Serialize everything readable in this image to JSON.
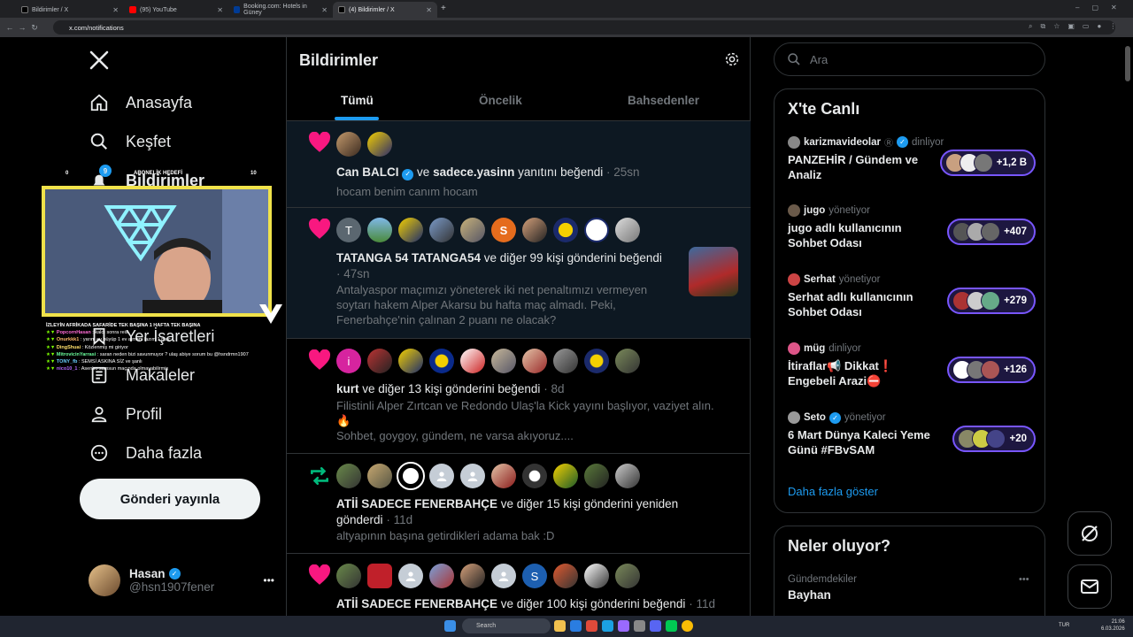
{
  "browser": {
    "tabs": [
      {
        "title": "Bildirimler / X",
        "active": false
      },
      {
        "title": "(95) YouTube",
        "active": false
      },
      {
        "title": "Booking.com: Hotels in Güney",
        "active": false
      },
      {
        "title": "(4) Bildirimler / X",
        "active": true
      }
    ],
    "url": "x.com/notifications",
    "new_tab": "+"
  },
  "nav": {
    "logo": "X",
    "items": [
      {
        "label": "Anasayfa",
        "icon": "home-icon"
      },
      {
        "label": "Keşfet",
        "icon": "search-icon"
      },
      {
        "label": "Bildirimler",
        "icon": "bell-icon",
        "badge": "9"
      },
      {
        "label": "Yer İşaretleri",
        "icon": "bookmark-icon"
      },
      {
        "label": "Makaleler",
        "icon": "article-icon"
      },
      {
        "label": "Profil",
        "icon": "person-icon"
      },
      {
        "label": "Daha fazla",
        "icon": "more-circle-icon"
      }
    ],
    "post_button": "Gönderi yayınla",
    "account": {
      "name": "Hasan",
      "handle": "@hsn1907fener",
      "more": "•••"
    }
  },
  "stream_overlay": {
    "goal_left": "0",
    "goal_title": "ABONELİK HEDEFİ",
    "goal_right": "10",
    "chat_header": "İZLEYİN AFRİKADA SAFARİDE TEK BAŞINA 1 HAFTA TEK BAŞINA",
    "chat": [
      {
        "user": "PopcornHasan",
        "msg": "kaldı sonra reis"
      },
      {
        "user": "Onurkkk1",
        "msg": "yarım ev büyüp 1 ev almam lazım 1 maç"
      },
      {
        "user": "DingShuai",
        "msg": "Közlenmiş mi giriyor"
      },
      {
        "user": "MitrovicinYarrasi",
        "msg": "saran neden bizi savunmuyor ? ulaş abiye sorum bu @hsndrmn1907"
      },
      {
        "user": "TONY_fb",
        "msg": "SEMSİ ASKINA SİZ ve şanlı"
      },
      {
        "user": "nico10_1",
        "msg": "Asenbo samsun maçında olmayabilirmiş"
      }
    ]
  },
  "main": {
    "title": "Bildirimler",
    "tabs": [
      "Tümü",
      "Öncelik",
      "Bahsedenler"
    ],
    "notifications": [
      {
        "type": "like",
        "avatar_count": 2,
        "actor1": "Can BALCI",
        "middle": "ve",
        "actor2": "sadece.yasinn",
        "action": "yanıtını beğendi",
        "time": "25sn",
        "text": "hocam benim canım hocam"
      },
      {
        "type": "like",
        "avatar_letter": "T",
        "actor1": "TATANGA 54 TATANGA54",
        "action": "ve diğer 99 kişi gönderini beğendi",
        "time": "47sn",
        "text": "Antalyaspor maçımızı yöneterek iki net penaltımızı vermeyen soytarı hakem Alper Akarsu bu hafta maç almadı. Peki, Fenerbahçe'nin çalınan 2 puanı ne olacak?"
      },
      {
        "type": "like",
        "avatar_letter": "i",
        "actor1": "kurt",
        "action": "ve diğer 13 kişi gönderini beğendi",
        "time": "8d",
        "text": "Filistinli Alper Zırtcan ve Redondo Ulaş'la Kick yayını başlıyor, vaziyet alın. 🔥",
        "text2": "Sohbet, goygoy, gündem, ne varsa akıyoruz...."
      },
      {
        "type": "repost",
        "actor1": "ATİİ SADECE FENERBAHÇE",
        "action": "ve diğer 15 kişi gönderini yeniden gönderdi",
        "time": "11d",
        "text": "altyapının başına getirdikleri adama bak :D"
      },
      {
        "type": "like",
        "avatar_letter": "S",
        "actor1": "ATİİ SADECE FENERBAHÇE",
        "action": "ve diğer 100 kişi gönderini beğendi",
        "time": "11d"
      }
    ]
  },
  "right": {
    "search_placeholder": "Ara",
    "live_title": "X'te Canlı",
    "live": [
      {
        "host": "karizmavideolar",
        "role": "dinliyor",
        "title": "PANZEHİR / Gündem ve Analiz",
        "count": "+1,2 B"
      },
      {
        "host": "jugo",
        "role": "yönetiyor",
        "title": "jugo adlı kullanıcının Sohbet Odası",
        "count": "+407"
      },
      {
        "host": "Serhat",
        "role": "yönetiyor",
        "title": "Serhat adlı kullanıcının Sohbet Odası",
        "count": "+279"
      },
      {
        "host": "müg",
        "role": "dinliyor",
        "title": "İtiraflar📢 Dikkat❗ Engebeli Arazi⛔",
        "count": "+126"
      },
      {
        "host": "Seto",
        "role": "yönetiyor",
        "title": "6 Mart Dünya Kaleci Yeme Günü #FBvSAM",
        "count": "+20"
      }
    ],
    "show_more": "Daha fazla göster",
    "trends_title": "Neler oluyor?",
    "trend": {
      "category": "Gündemdekiler",
      "name": "Bayhan",
      "more": "•••"
    }
  },
  "taskbar": {
    "search": "Search",
    "lang": "TUR",
    "time": "21:06",
    "date": "6.03.2026"
  },
  "colors": {
    "accent": "#1d9bf0",
    "like": "#f91880",
    "repost": "#00ba7c",
    "live": "#7856ff"
  }
}
